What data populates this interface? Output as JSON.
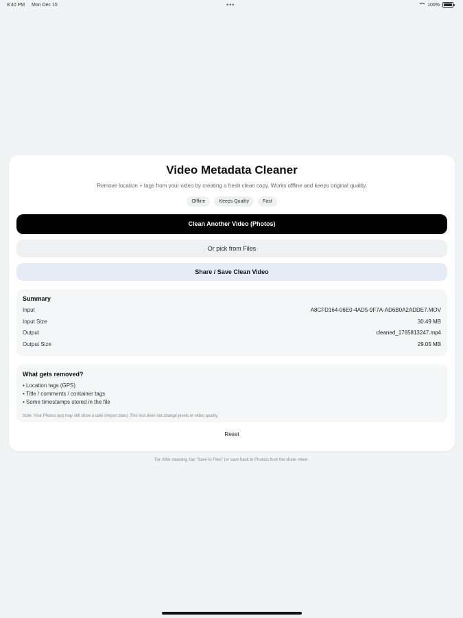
{
  "status_bar": {
    "time": "8:40 PM",
    "date": "Mon Dec 15",
    "dots": "•••",
    "battery": "100%"
  },
  "app": {
    "title": "Video Metadata Cleaner",
    "subtitle": "Remove location + tags from your video by creating a fresh clean copy. Works offline and keeps original quality.",
    "chips": [
      "Offline",
      "Keeps Quality",
      "Fast"
    ]
  },
  "buttons": {
    "clean_another": "Clean Another Video (Photos)",
    "pick_files": "Or pick from Files",
    "share_save": "Share / Save Clean Video",
    "reset": "Reset"
  },
  "summary": {
    "title": "Summary",
    "rows": [
      {
        "label": "Input",
        "value": "A8CFD164-06E0-4AD5-9F7A-AD6B0A2ADDE7.MOV"
      },
      {
        "label": "Input Size",
        "value": "30.49 MB"
      },
      {
        "label": "Output",
        "value": "cleaned_1765813247.mp4"
      },
      {
        "label": "Output Size",
        "value": "29.05 MB"
      }
    ]
  },
  "removed": {
    "title": "What gets removed?",
    "items": [
      "• Location tags (GPS)",
      "• Title / comments / container tags",
      "• Some timestamps stored in the file"
    ],
    "note": "Note: Your Photos app may still show a date (import date). This tool does not change pixels or video quality."
  },
  "tip": "Tip: After cleaning, tap \"Save to Files\" (or save back to Photos) from the share sheet."
}
